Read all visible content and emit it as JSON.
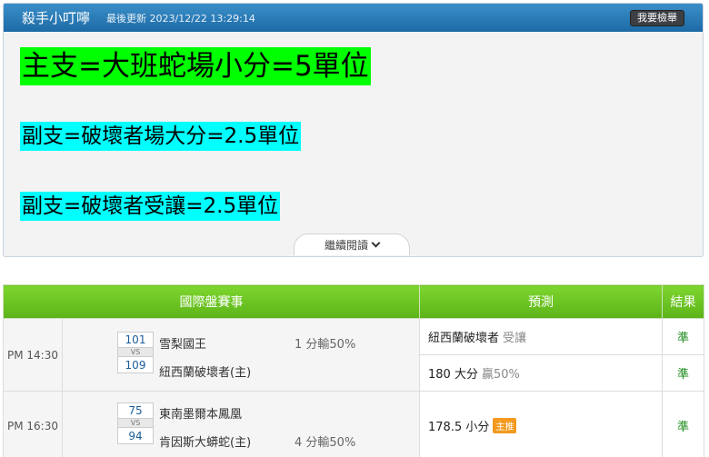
{
  "header": {
    "title": "殺手小叮嚀",
    "updated": "最後更新 2023/12/22 13:29:14",
    "buy_label": "我要檢舉"
  },
  "notes": {
    "line1": "主支=大班蛇場小分=5單位",
    "line2": "副支=破壞者場大分=2.5單位",
    "line3": "副支=破壞者受讓=2.5單位"
  },
  "more_label": "繼續閱讀",
  "colors": {
    "header_blue": "#1d6aa6",
    "table_green": "#5cb318",
    "hl_green": "#00ff00",
    "hl_cyan": "#00ffff",
    "hit": "#1a8a1a",
    "tag_orange": "#f39a1e"
  },
  "table": {
    "headers": [
      "國際盤賽事",
      "預測",
      "結果"
    ],
    "matches": [
      {
        "time": "PM 14:30",
        "score_top": "101",
        "vs": "VS",
        "score_bottom": "109",
        "team_top": "雪梨國王",
        "team_bottom": "紐西蘭破壞者(主)",
        "handicap": "1 分輸50%",
        "pick1_main": "紐西蘭破壞者",
        "pick1_sub": "受讓",
        "result1": "準",
        "pick2_main": "180 大分",
        "pick2_sub": "贏50%",
        "result2": "準"
      },
      {
        "time": "PM 16:30",
        "score_top": "75",
        "vs": "VS",
        "score_bottom": "94",
        "team_top": "東南墨爾本鳳凰",
        "team_bottom": "肯因斯大蟒蛇(主)",
        "handicap": "4 分輸50%",
        "pick1_main": "178.5 小分",
        "pick1_tag": "主推",
        "result1": "準"
      }
    ]
  }
}
